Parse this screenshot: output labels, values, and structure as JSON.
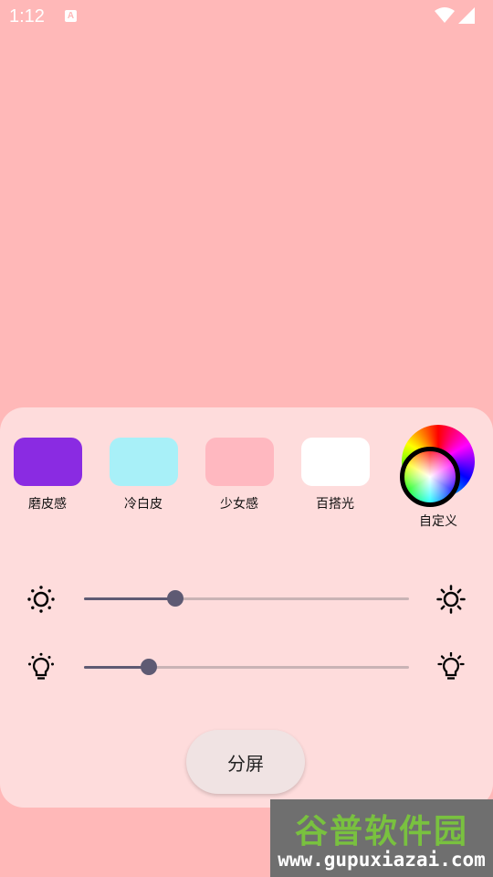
{
  "status_bar": {
    "time": "1:12",
    "notification_badge": "A"
  },
  "colors": {
    "background": "#FFB8B8",
    "panel": "#FEDCDC",
    "slider_active": "#5E5A73",
    "slider_inactive": "#C9B3B5"
  },
  "presets": [
    {
      "label": "磨皮感",
      "color": "#8A2BE2"
    },
    {
      "label": "冷白皮",
      "color": "#A8F0F8"
    },
    {
      "label": "少女感",
      "color": "#FFB8C0"
    },
    {
      "label": "百搭光",
      "color": "#FFFFFF"
    }
  ],
  "custom": {
    "label": "自定义"
  },
  "sliders": {
    "brightness": {
      "value": 0.28,
      "left_icon": "brightness-low-icon",
      "right_icon": "brightness-high-icon"
    },
    "light": {
      "value": 0.2,
      "left_icon": "bulb-low-icon",
      "right_icon": "bulb-high-icon"
    }
  },
  "split_button": {
    "label": "分屏"
  },
  "watermark": {
    "title": "谷普软件园",
    "url": "www.gupuxiazai.com"
  }
}
